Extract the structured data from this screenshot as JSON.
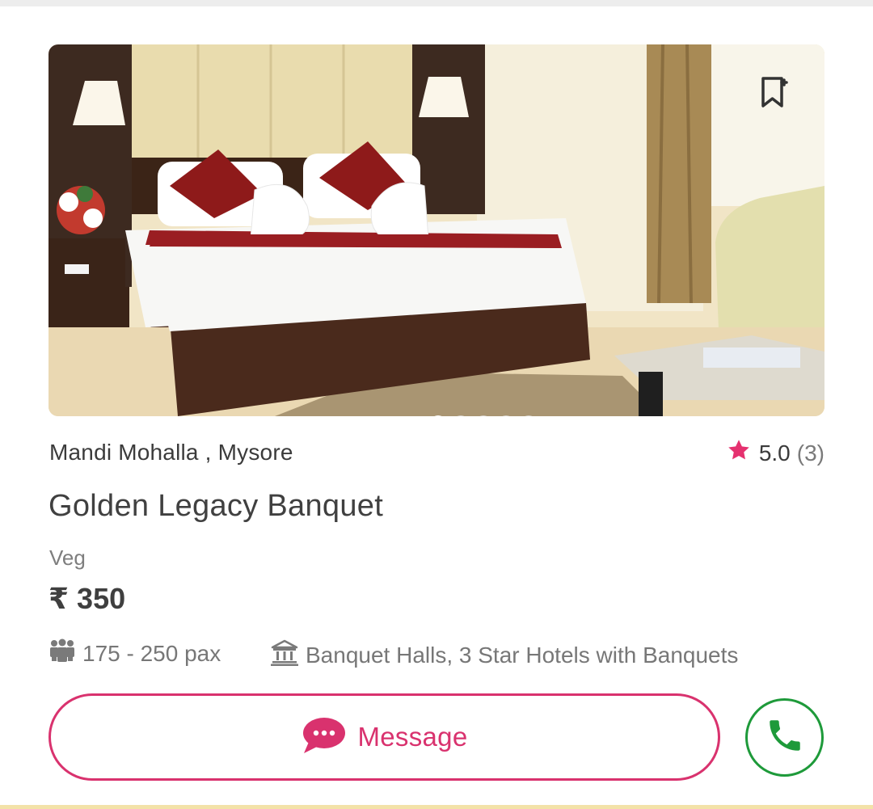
{
  "listing": {
    "location": "Mandi Mohalla , Mysore",
    "rating": "5.0",
    "review_count": "(3)",
    "title": "Golden Legacy Banquet",
    "food_type": "Veg",
    "price": "₹ 350",
    "capacity": "175 - 250 pax",
    "venue_type": "Banquet Halls, 3 Star Hotels with Banquets"
  },
  "gallery": {
    "total_images": 5,
    "active_index": 0
  },
  "actions": {
    "message_label": "Message"
  },
  "icons": {
    "bookmark": "bookmark-icon",
    "rating": "star-icon",
    "capacity": "people-icon",
    "venue_type": "building-icon",
    "message": "chat-bubble-icon",
    "call": "phone-icon"
  },
  "colors": {
    "brand_pink": "#d9326e",
    "star_pink": "#e5316f",
    "call_green": "#1e9a3a",
    "text_dark": "#3b3b3b",
    "text_muted": "#7e7e7e"
  }
}
